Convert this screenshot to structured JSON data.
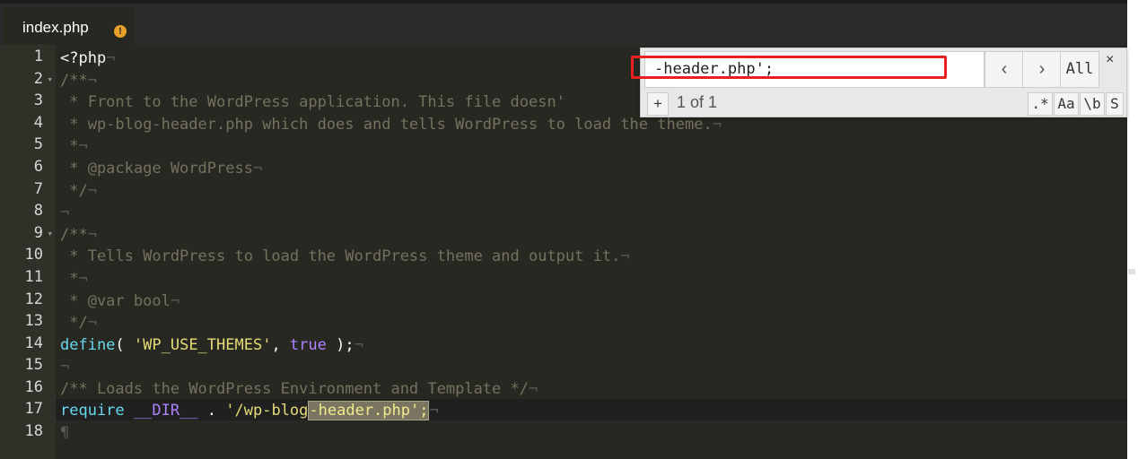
{
  "tab": {
    "filename": "index.php",
    "modified_indicator": "!"
  },
  "search": {
    "query": "-header.php';",
    "counter": "1 of 1",
    "prev_label": "‹",
    "next_label": "›",
    "all_label": "All",
    "close_label": "×",
    "replace_toggle_label": "+",
    "regex_label": ".*",
    "case_label": "Aa",
    "word_label": "\\b",
    "selection_label": "S"
  },
  "colors": {
    "highlight": "#7a7560",
    "active_tab_underline": "#4fae3a",
    "search_annotation": "#e8201f"
  },
  "editor": {
    "active_line": 17,
    "lines": [
      {
        "num": "1",
        "fold": ""
      },
      {
        "num": "2",
        "fold": "▾"
      },
      {
        "num": "3",
        "fold": ""
      },
      {
        "num": "4",
        "fold": ""
      },
      {
        "num": "5",
        "fold": ""
      },
      {
        "num": "6",
        "fold": ""
      },
      {
        "num": "7",
        "fold": ""
      },
      {
        "num": "8",
        "fold": ""
      },
      {
        "num": "9",
        "fold": "▾"
      },
      {
        "num": "10",
        "fold": ""
      },
      {
        "num": "11",
        "fold": ""
      },
      {
        "num": "12",
        "fold": ""
      },
      {
        "num": "13",
        "fold": ""
      },
      {
        "num": "14",
        "fold": ""
      },
      {
        "num": "15",
        "fold": ""
      },
      {
        "num": "16",
        "fold": ""
      },
      {
        "num": "17",
        "fold": ""
      },
      {
        "num": "18",
        "fold": ""
      }
    ],
    "code": {
      "l1": "<?php",
      "l2": "/**",
      "l3_a": " * Front to the WordPress application. This file doesn'",
      "l4_a": " * wp-blog-header.php which does and tells WordPress to load the theme.",
      "l5_a": " *",
      "l6_a": " * @package WordPress",
      "l7_a": " */",
      "l9_a": "/**",
      "l10_a": " * Tells WordPress to load the WordPress theme and output it.",
      "l11_a": " *",
      "l12_a": " * @var bool",
      "l13_a": " */",
      "l14_fn": "define",
      "l14_open": "( ",
      "l14_str": "'WP_USE_THEMES'",
      "l14_comma": ", ",
      "l14_bool": "true",
      "l14_close": " );",
      "l16_a": "/** Loads the WordPress Environment and Template */",
      "l17_kw": "require",
      "l17_const": "__DIR__",
      "l17_dot": " . ",
      "l17_str1": "'/wp-blog",
      "l17_match": "-header.php';",
      "pilcrow": "¶",
      "eol": "¬"
    }
  }
}
